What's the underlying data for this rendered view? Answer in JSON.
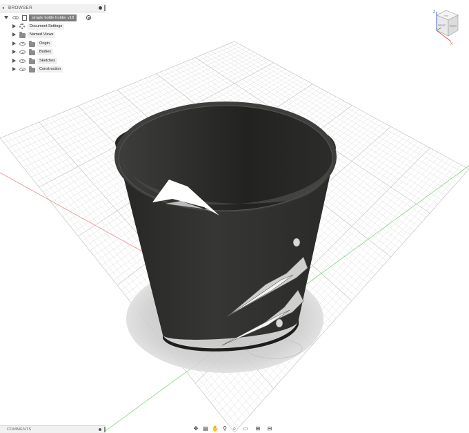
{
  "browser": {
    "title": "BROWSER",
    "document_name": "simple bottle holder v18",
    "items": [
      {
        "label": "Document Settings",
        "icon": "gear-icon",
        "eye": false
      },
      {
        "label": "Named Views",
        "icon": "folder-icon",
        "eye": false
      },
      {
        "label": "Origin",
        "icon": "folder-icon",
        "eye": true
      },
      {
        "label": "Bodies",
        "icon": "folder-icon",
        "eye": true
      },
      {
        "label": "Sketches",
        "icon": "folder-icon",
        "eye": true
      },
      {
        "label": "Construction",
        "icon": "folder-icon",
        "eye": true
      }
    ]
  },
  "comments": {
    "title": "COMMENTS"
  },
  "viewcube": {
    "top": "TOP",
    "front": "FRONT",
    "right": "RIGHT",
    "axis_z": "Z",
    "axis_x": "X"
  },
  "toolbar": {
    "buttons": [
      "orbit-icon",
      "look-at-icon",
      "pan-icon",
      "zoom-icon",
      "fit-icon",
      "display-settings-icon",
      "grid-icon",
      "viewports-icon"
    ]
  },
  "colors": {
    "model": "#2b2b29",
    "grid": "#d2d2d2",
    "axis_red": "#e07a7a",
    "axis_green": "#7ccf7c",
    "background": "#ffffff"
  }
}
